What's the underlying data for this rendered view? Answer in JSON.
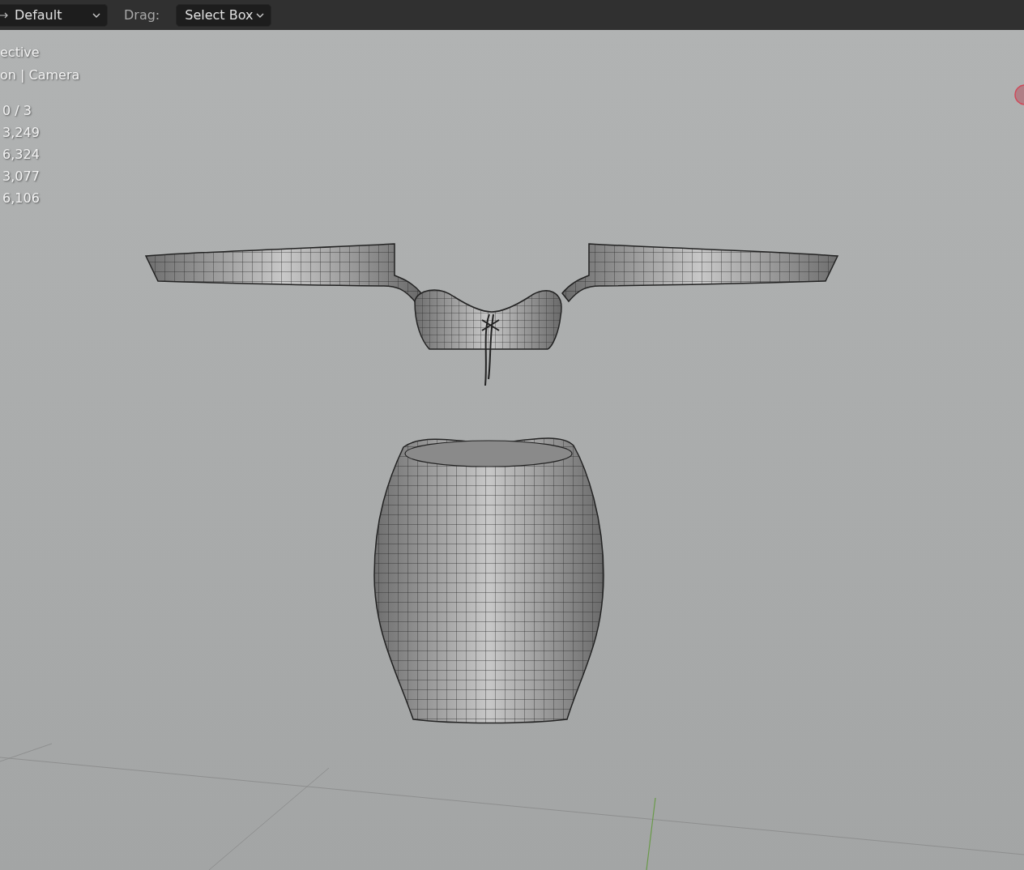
{
  "header": {
    "mode_dropdown": {
      "value": "Default"
    },
    "drag_label": "Drag:",
    "drag_dropdown": {
      "value": "Select Box"
    }
  },
  "viewport": {
    "view_info": [
      "ective",
      "on | Camera"
    ],
    "stats": [
      "0 / 3",
      "3,249",
      "6,324",
      "3,077",
      "6,106"
    ]
  }
}
